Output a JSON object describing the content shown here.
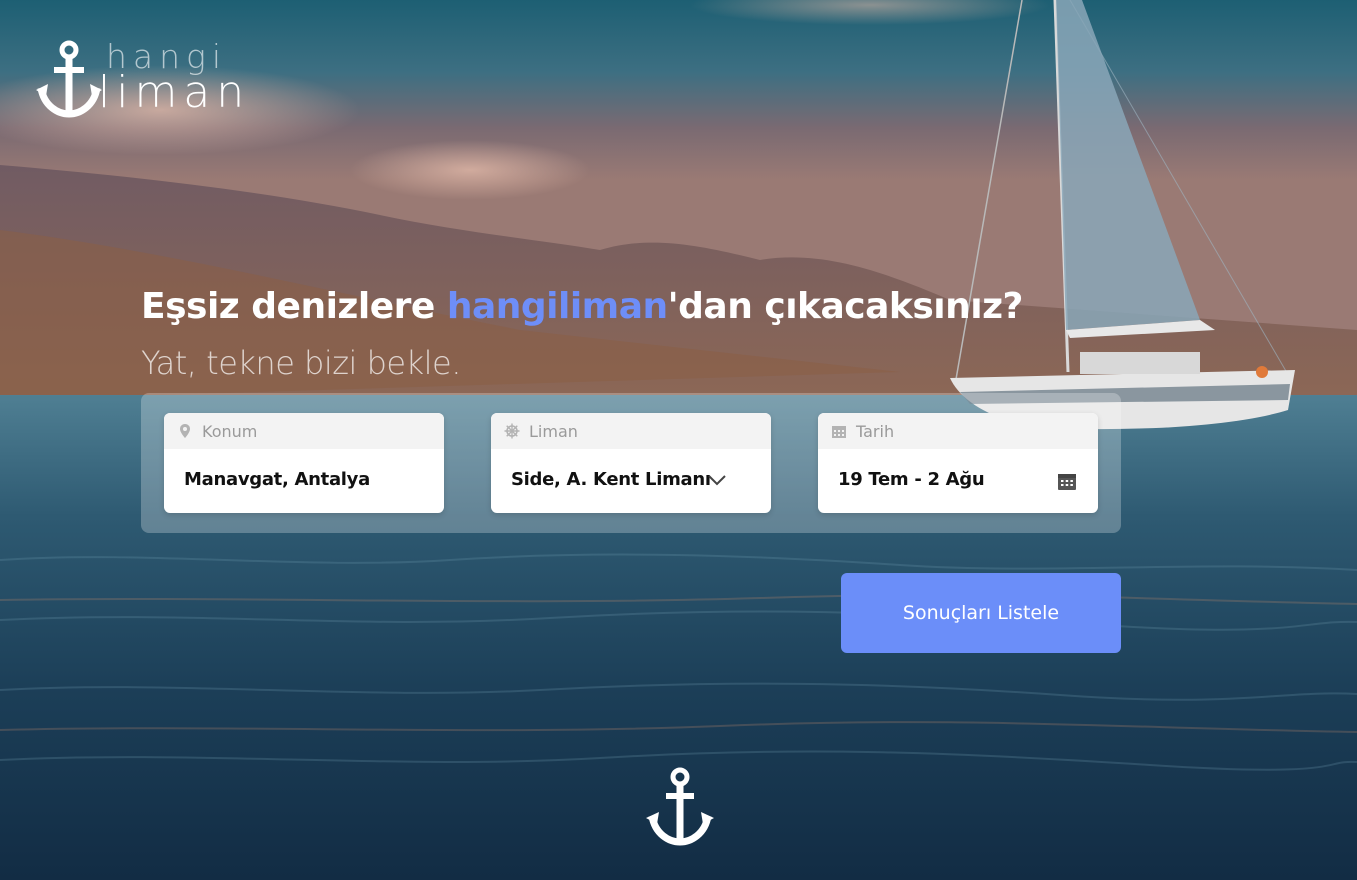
{
  "brand": {
    "line1": "hangi",
    "line2": "liman"
  },
  "hero": {
    "headline_pre": "Eşsiz denizlere ",
    "headline_accent": "hangiliman",
    "headline_post": "'dan çıkacaksınız?",
    "subline": "Yat, tekne bizi bekle."
  },
  "search": {
    "location": {
      "label": "Konum",
      "value": "Manavgat, Antalya",
      "icon": "map-pin-icon"
    },
    "marina": {
      "label": "Liman",
      "value": "Side, A. Kent Limanı",
      "icon": "ship-wheel-icon"
    },
    "date": {
      "label": "Tarih",
      "value": "19 Tem - 2 Ağu",
      "icon": "calendar-icon"
    },
    "submit_label": "Sonuçları Listele"
  },
  "colors": {
    "accent": "#6b8ef9",
    "headline_accent": "#6e8ef8"
  }
}
